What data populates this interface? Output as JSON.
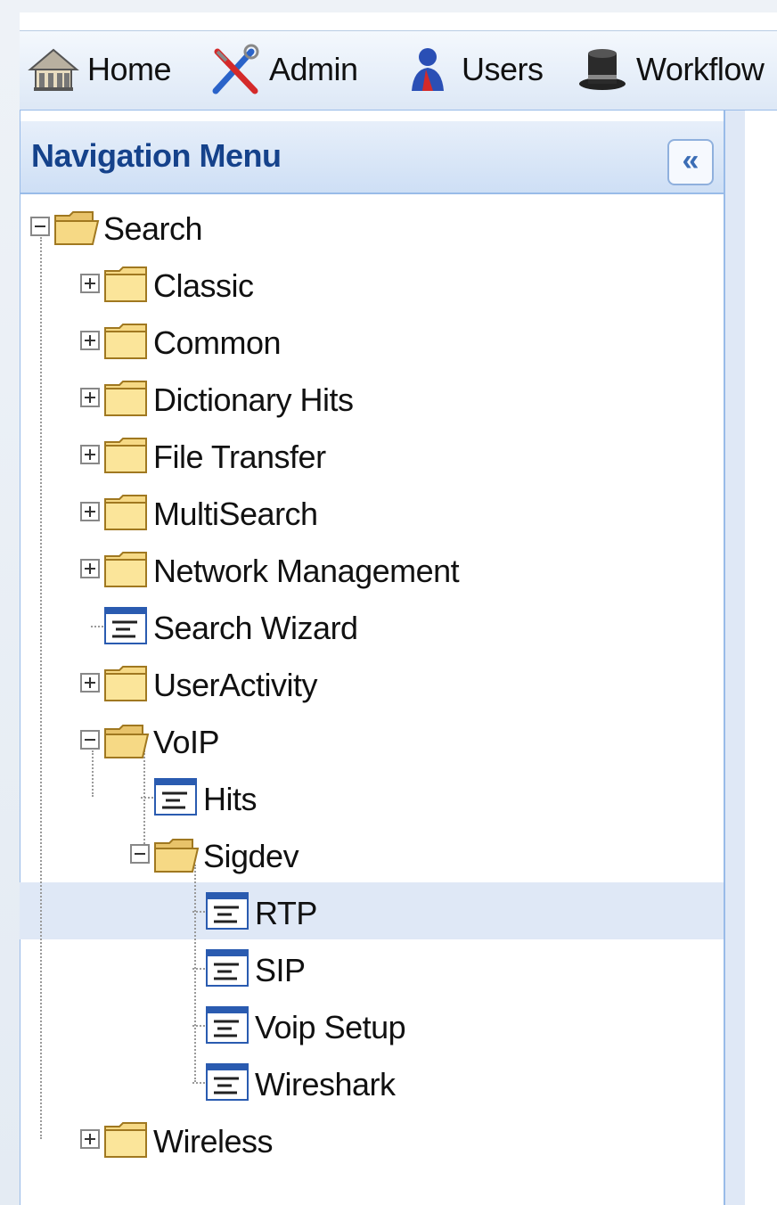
{
  "toolbar": {
    "items": [
      {
        "label": "Home",
        "icon": "home-icon"
      },
      {
        "label": "Admin",
        "icon": "admin-tools-icon"
      },
      {
        "label": "Users",
        "icon": "user-icon"
      },
      {
        "label": "Workflow",
        "icon": "top-hat-icon"
      }
    ]
  },
  "nav": {
    "title": "Navigation Menu",
    "collapse_label": "«"
  },
  "tree": {
    "root": "Search",
    "items": [
      {
        "label": "Classic",
        "type": "folder",
        "state": "collapsed"
      },
      {
        "label": "Common",
        "type": "folder",
        "state": "collapsed"
      },
      {
        "label": "Dictionary Hits",
        "type": "folder",
        "state": "collapsed"
      },
      {
        "label": "File Transfer",
        "type": "folder",
        "state": "collapsed"
      },
      {
        "label": "MultiSearch",
        "type": "folder",
        "state": "collapsed"
      },
      {
        "label": "Network Management",
        "type": "folder",
        "state": "collapsed"
      },
      {
        "label": "Search Wizard",
        "type": "leaf"
      },
      {
        "label": "UserActivity",
        "type": "folder",
        "state": "collapsed"
      },
      {
        "label": "VoIP",
        "type": "folder",
        "state": "expanded"
      },
      {
        "label": "Hits",
        "type": "leaf"
      },
      {
        "label": "Sigdev",
        "type": "folder",
        "state": "expanded"
      },
      {
        "label": "RTP",
        "type": "leaf",
        "selected": true
      },
      {
        "label": "SIP",
        "type": "leaf"
      },
      {
        "label": "Voip Setup",
        "type": "leaf"
      },
      {
        "label": "Wireshark",
        "type": "leaf"
      },
      {
        "label": "Wireless",
        "type": "folder",
        "state": "collapsed"
      }
    ]
  },
  "colors": {
    "header_text": "#15428b",
    "selection": "#dfe8f6",
    "border": "#99bbe8"
  }
}
